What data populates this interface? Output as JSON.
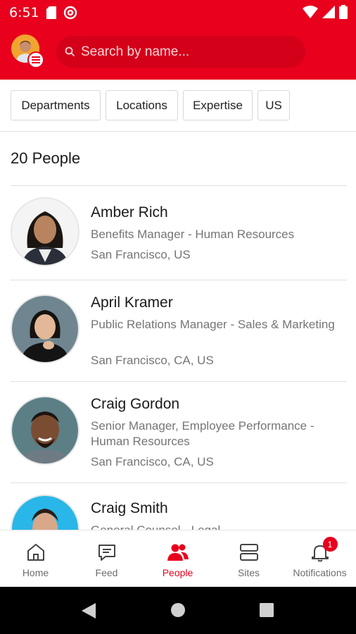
{
  "status_bar": {
    "time": "6:51",
    "left_icons": [
      "sd-card-icon",
      "at-sign-icon"
    ],
    "right_icons": [
      "wifi-icon",
      "signal-icon",
      "battery-icon"
    ]
  },
  "header": {
    "search_placeholder": "Search by name...",
    "accent_color": "#e8001d"
  },
  "filters": [
    "Departments",
    "Locations",
    "Expertise",
    "US"
  ],
  "people_count": "20 People",
  "people": [
    {
      "name": "Amber Rich",
      "role": "Benefits Manager - Human Resources",
      "location": "San Francisco, US"
    },
    {
      "name": "April Kramer",
      "role": "Public Relations Manager - Sales & Marketing",
      "location": "San Francisco, CA, US"
    },
    {
      "name": "Craig Gordon",
      "role": "Senior Manager, Employee Performance - Human Resources",
      "location": "San Francisco, CA, US"
    },
    {
      "name": "Craig Smith",
      "role": "General Counsel - Legal",
      "location": ""
    }
  ],
  "bottom_nav": [
    {
      "label": "Home",
      "icon": "home-icon"
    },
    {
      "label": "Feed",
      "icon": "chat-bubble-icon"
    },
    {
      "label": "People",
      "icon": "people-icon",
      "active": true
    },
    {
      "label": "Sites",
      "icon": "sites-icon"
    },
    {
      "label": "Notifications",
      "icon": "bell-icon",
      "badge": "1"
    }
  ],
  "system_nav": [
    "back-icon",
    "home-circle-icon",
    "recents-icon"
  ]
}
